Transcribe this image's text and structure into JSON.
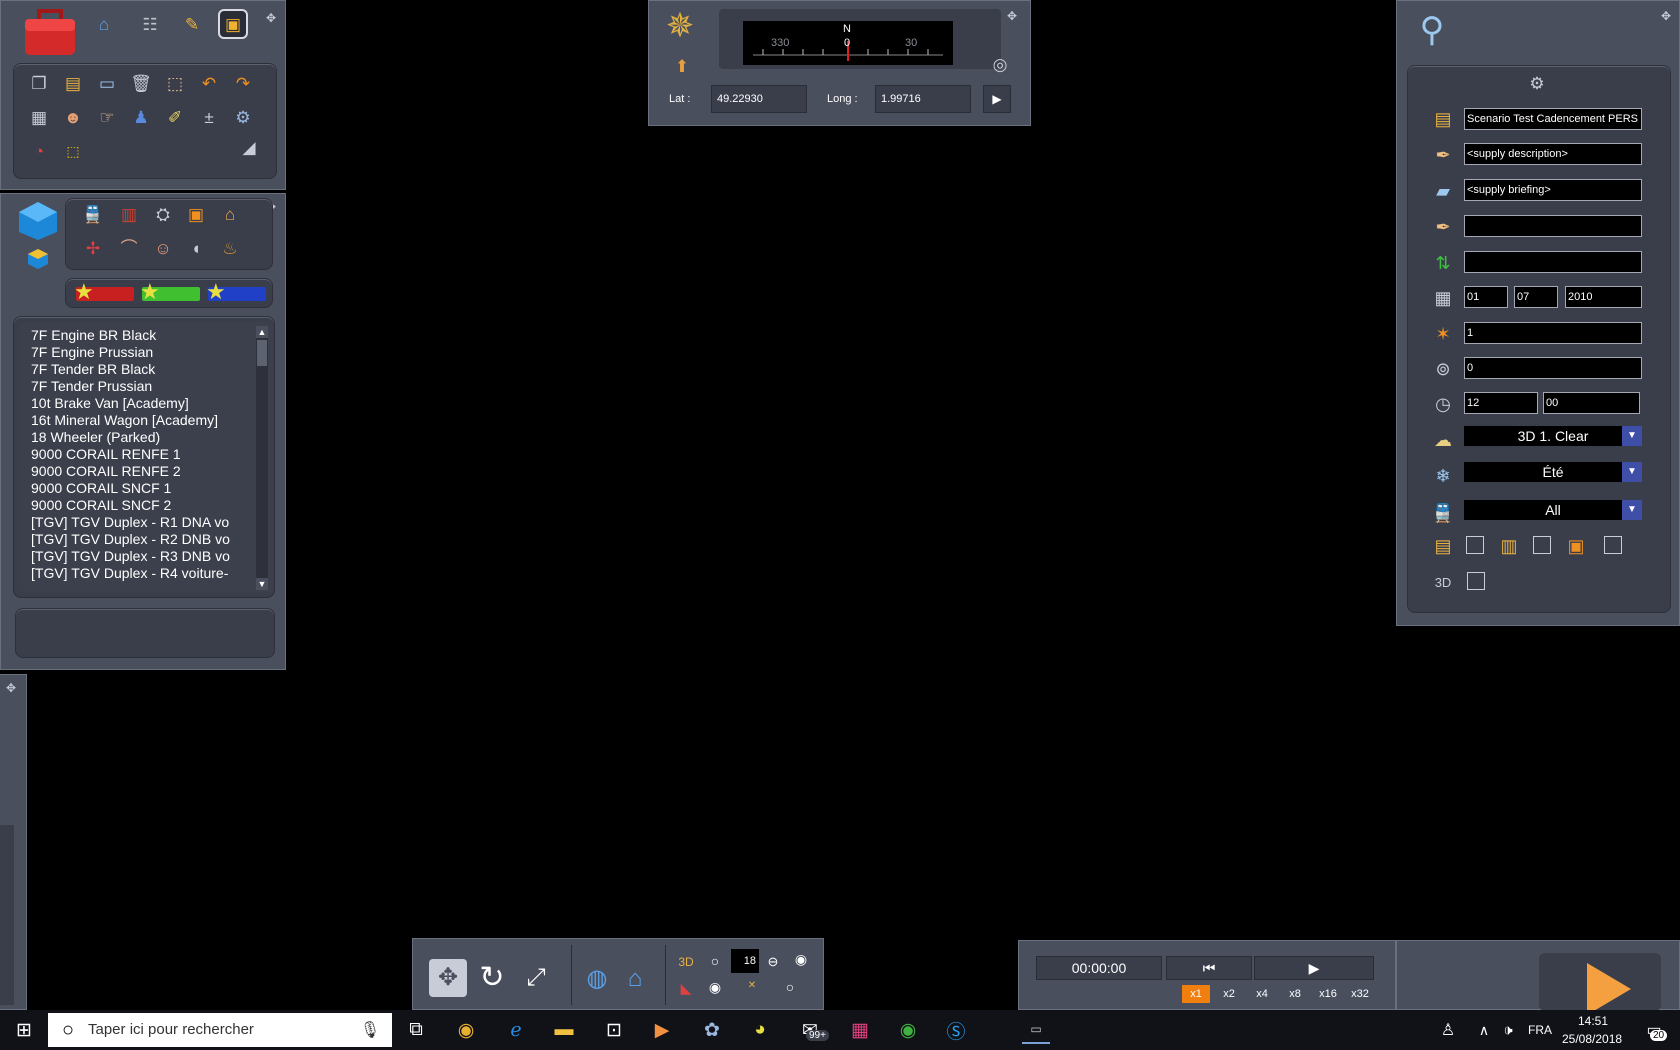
{
  "colors": {
    "panel": "#4a4f5e",
    "inset": "#3a3e4b",
    "accent_orange": "#f07f10",
    "dropdown_arrow": "#3f4fa8",
    "taskbar": "#101218"
  },
  "toolbar": {
    "icons": [
      "toolbox-icon",
      "home-icon",
      "track-icon",
      "brush-icon",
      "train-front-icon"
    ],
    "tools_row1": [
      "copy-icon",
      "paste-icon",
      "monitor-icon",
      "trash-icon",
      "stamp-icon",
      "undo-icon",
      "redo-icon"
    ],
    "tools_row2": [
      "document-icon",
      "portrait-icon",
      "pointer-hand-icon",
      "people-icon",
      "edit-icon",
      "add-person-icon",
      "settings-doc-icon"
    ],
    "tools_row3": [
      "clock-chart-icon",
      "selection-rect-icon",
      "spotlight-icon"
    ]
  },
  "asset_panel": {
    "category_icons": [
      "locomotive-icon",
      "wagon-icon",
      "engine-icon",
      "train-icon",
      "house-icon",
      "signal-icon",
      "bridge-icon",
      "face-icon",
      "horn-icon",
      "sack-icon"
    ],
    "items": [
      "7F Engine BR Black",
      "7F Engine Prussian",
      "7F Tender BR Black",
      "7F Tender Prussian",
      "10t Brake Van [Academy]",
      "16t Mineral Wagon [Academy]",
      "18 Wheeler (Parked)",
      "9000 CORAIL RENFE 1",
      "9000 CORAIL RENFE 2",
      "9000 CORAIL SNCF 1",
      "9000 CORAIL SNCF 2",
      "[TGV] TGV Duplex - R1 DNA vo",
      "[TGV] TGV Duplex - R2 DNB vo",
      "[TGV] TGV Duplex - R3 DNB vo",
      "[TGV] TGV Duplex - R4 voiture-"
    ]
  },
  "compass": {
    "north_label": "N",
    "ticks": [
      "330",
      "0",
      "30"
    ],
    "lat_label": "Lat :",
    "lat_value": "49.22930",
    "long_label": "Long :",
    "long_value": "1.99716"
  },
  "scenario": {
    "name": "Scenario Test Cadencement PERS",
    "description": "<supply description>",
    "briefing": "<supply briefing>",
    "author": "",
    "route": "",
    "day": "01",
    "month": "07",
    "year": "2010",
    "rating": "1",
    "value_field": "0",
    "hour": "12",
    "minute": "00",
    "weather": "3D 1. Clear",
    "season": "Été",
    "filter": "All"
  },
  "bottom_toolbar": {
    "view_count": "18"
  },
  "timeline": {
    "time": "00:00:00",
    "speeds": [
      "x1",
      "x2",
      "x4",
      "x8",
      "x16",
      "x32"
    ],
    "active_speed": "x1"
  },
  "taskbar": {
    "search_placeholder": "Taper ici pour rechercher",
    "badge": "99+",
    "language": "FRA",
    "time": "14:51",
    "date": "25/08/2018",
    "notifications": "20"
  }
}
